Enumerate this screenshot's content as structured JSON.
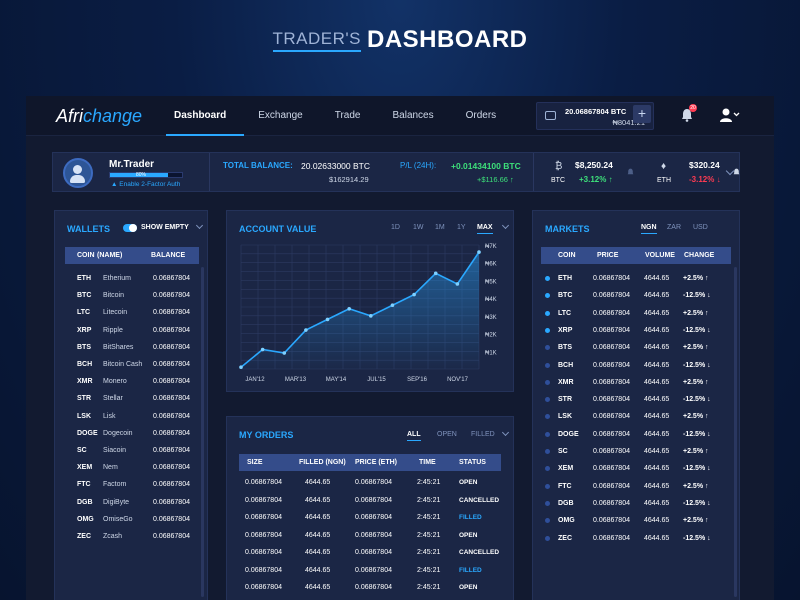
{
  "hero": {
    "thin": "TRADER'S",
    "bold": "DASHBOARD"
  },
  "topbar": {
    "logo_a": "Afri",
    "logo_b": "change",
    "nav": [
      "Dashboard",
      "Exchange",
      "Trade",
      "Balances",
      "Orders"
    ],
    "wallet_btc": "20.06867804 BTC",
    "wallet_ngn": "₦8041.21",
    "plus": "+",
    "bell_badge": "20"
  },
  "profile": {
    "name": "Mr.Trader",
    "progress_pct": 80,
    "progress_label": "80%",
    "twofa": "Enable 2-Factor Auth",
    "total_label": "TOTAL BALANCE:",
    "total_btc": "20.02633000 BTC",
    "total_usd": "$162914.29",
    "pl_label": "P/L (24H):",
    "pl_btc": "+0.01434100 BTC",
    "pl_usd": "+$116.66 ↑",
    "coins": [
      {
        "symbol": "₿",
        "label": "BTC",
        "price": "$8,250.24",
        "change": "+3.12% ↑",
        "dir": "pos"
      },
      {
        "symbol": "♦",
        "label": "ETH",
        "price": "$320.24",
        "change": "-3.12% ↓",
        "dir": "neg"
      }
    ]
  },
  "wallets": {
    "title": "WALLETS",
    "toggle_label": "SHOW EMPTY",
    "headers": [
      "COIN",
      "(NAME)",
      "BALANCE"
    ],
    "rows": [
      [
        "ETH",
        "Etherium",
        "0.06867804"
      ],
      [
        "BTC",
        "Bitcoin",
        "0.06867804"
      ],
      [
        "LTC",
        "Litecoin",
        "0.06867804"
      ],
      [
        "XRP",
        "Ripple",
        "0.06867804"
      ],
      [
        "BTS",
        "BitShares",
        "0.06867804"
      ],
      [
        "BCH",
        "Bitcoin Cash",
        "0.06867804"
      ],
      [
        "XMR",
        "Monero",
        "0.06867804"
      ],
      [
        "STR",
        "Stellar",
        "0.06867804"
      ],
      [
        "LSK",
        "Lisk",
        "0.06867804"
      ],
      [
        "DOGE",
        "Dogecoin",
        "0.06867804"
      ],
      [
        "SC",
        "Siacoin",
        "0.06867804"
      ],
      [
        "XEM",
        "Nem",
        "0.06867804"
      ],
      [
        "FTC",
        "Factom",
        "0.06867804"
      ],
      [
        "DGB",
        "DigiByte",
        "0.06867804"
      ],
      [
        "OMG",
        "OmiseGo",
        "0.06867804"
      ],
      [
        "ZEC",
        "Zcash",
        "0.06867804"
      ]
    ]
  },
  "account": {
    "title": "ACCOUNT VALUE",
    "ranges": [
      "1D",
      "1W",
      "1M",
      "1Y",
      "MAX"
    ],
    "active_range": "MAX",
    "x_labels": [
      "JAN'12",
      "MAR'13",
      "MAY'14",
      "JUL'15",
      "SEP'16",
      "NOV'17"
    ],
    "y_labels": [
      "₦7K",
      "₦6K",
      "₦5K",
      "₦4K",
      "₦3K",
      "₦2K",
      "₦1K"
    ]
  },
  "chart_data": {
    "type": "area",
    "title": "ACCOUNT VALUE",
    "x": [
      "JAN'12",
      "MAR'13",
      "MAY'14",
      "JUL'15",
      "SEP'16",
      "NOV'17"
    ],
    "series": [
      {
        "values": [
          0.1,
          1.1,
          0.9,
          2.2,
          2.8,
          3.4,
          3.0,
          3.6,
          4.2,
          5.4,
          4.8,
          6.6
        ]
      }
    ],
    "ylim": [
      0,
      7
    ],
    "ylabel_position": "right",
    "grid": true
  },
  "orders": {
    "title": "MY ORDERS",
    "tabs": [
      "ALL",
      "OPEN",
      "FILLED"
    ],
    "headers": [
      "SIZE",
      "FILLED (NGN)",
      "PRICE (ETH)",
      "TIME",
      "STATUS"
    ],
    "rows": [
      [
        "0.06867804",
        "4644.65",
        "0.06867804",
        "2:45:21",
        "OPEN"
      ],
      [
        "0.06867804",
        "4644.65",
        "0.06867804",
        "2:45:21",
        "CANCELLED"
      ],
      [
        "0.06867804",
        "4644.65",
        "0.06867804",
        "2:45:21",
        "FILLED"
      ],
      [
        "0.06867804",
        "4644.65",
        "0.06867804",
        "2:45:21",
        "OPEN"
      ],
      [
        "0.06867804",
        "4644.65",
        "0.06867804",
        "2:45:21",
        "CANCELLED"
      ],
      [
        "0.06867804",
        "4644.65",
        "0.06867804",
        "2:45:21",
        "FILLED"
      ],
      [
        "0.06867804",
        "4644.65",
        "0.06867804",
        "2:45:21",
        "OPEN"
      ]
    ]
  },
  "markets": {
    "title": "MARKETS",
    "tabs": [
      "NGN",
      "ZAR",
      "USD"
    ],
    "headers": [
      "COIN",
      "PRICE",
      "VOLUME",
      "CHANGE"
    ],
    "rows": [
      [
        "ETH",
        "0.06867804",
        "4644.65",
        "+2.5% ↑",
        "pos",
        "#2aa8ff"
      ],
      [
        "BTC",
        "0.06867804",
        "4644.65",
        "-12.5% ↓",
        "neg",
        "#2aa8ff"
      ],
      [
        "LTC",
        "0.06867804",
        "4644.65",
        "+2.5% ↑",
        "pos",
        "#2aa8ff"
      ],
      [
        "XRP",
        "0.06867804",
        "4644.65",
        "-12.5% ↓",
        "neg",
        "#2aa8ff"
      ],
      [
        "BTS",
        "0.06867804",
        "4644.65",
        "+2.5% ↑",
        "pos",
        "#2f4f9a"
      ],
      [
        "BCH",
        "0.06867804",
        "4644.65",
        "-12.5% ↓",
        "neg",
        "#2f4f9a"
      ],
      [
        "XMR",
        "0.06867804",
        "4644.65",
        "+2.5% ↑",
        "pos",
        "#2f4f9a"
      ],
      [
        "STR",
        "0.06867804",
        "4644.65",
        "-12.5% ↓",
        "neg",
        "#2f4f9a"
      ],
      [
        "LSK",
        "0.06867804",
        "4644.65",
        "+2.5% ↑",
        "pos",
        "#2f4f9a"
      ],
      [
        "DOGE",
        "0.06867804",
        "4644.65",
        "-12.5% ↓",
        "neg",
        "#2f4f9a"
      ],
      [
        "SC",
        "0.06867804",
        "4644.65",
        "+2.5% ↑",
        "pos",
        "#2f4f9a"
      ],
      [
        "XEM",
        "0.06867804",
        "4644.65",
        "-12.5% ↓",
        "neg",
        "#2f4f9a"
      ],
      [
        "FTC",
        "0.06867804",
        "4644.65",
        "+2.5% ↑",
        "pos",
        "#2f4f9a"
      ],
      [
        "DGB",
        "0.06867804",
        "4644.65",
        "-12.5% ↓",
        "neg",
        "#2f4f9a"
      ],
      [
        "OMG",
        "0.06867804",
        "4644.65",
        "+2.5% ↑",
        "pos",
        "#2f4f9a"
      ],
      [
        "ZEC",
        "0.06867804",
        "4644.65",
        "-12.5% ↓",
        "neg",
        "#2f4f9a"
      ]
    ]
  },
  "colors": {
    "accent": "#2aa8ff",
    "positive": "#3de07a",
    "negative": "#ff3b52",
    "panel": "#1b2645"
  }
}
